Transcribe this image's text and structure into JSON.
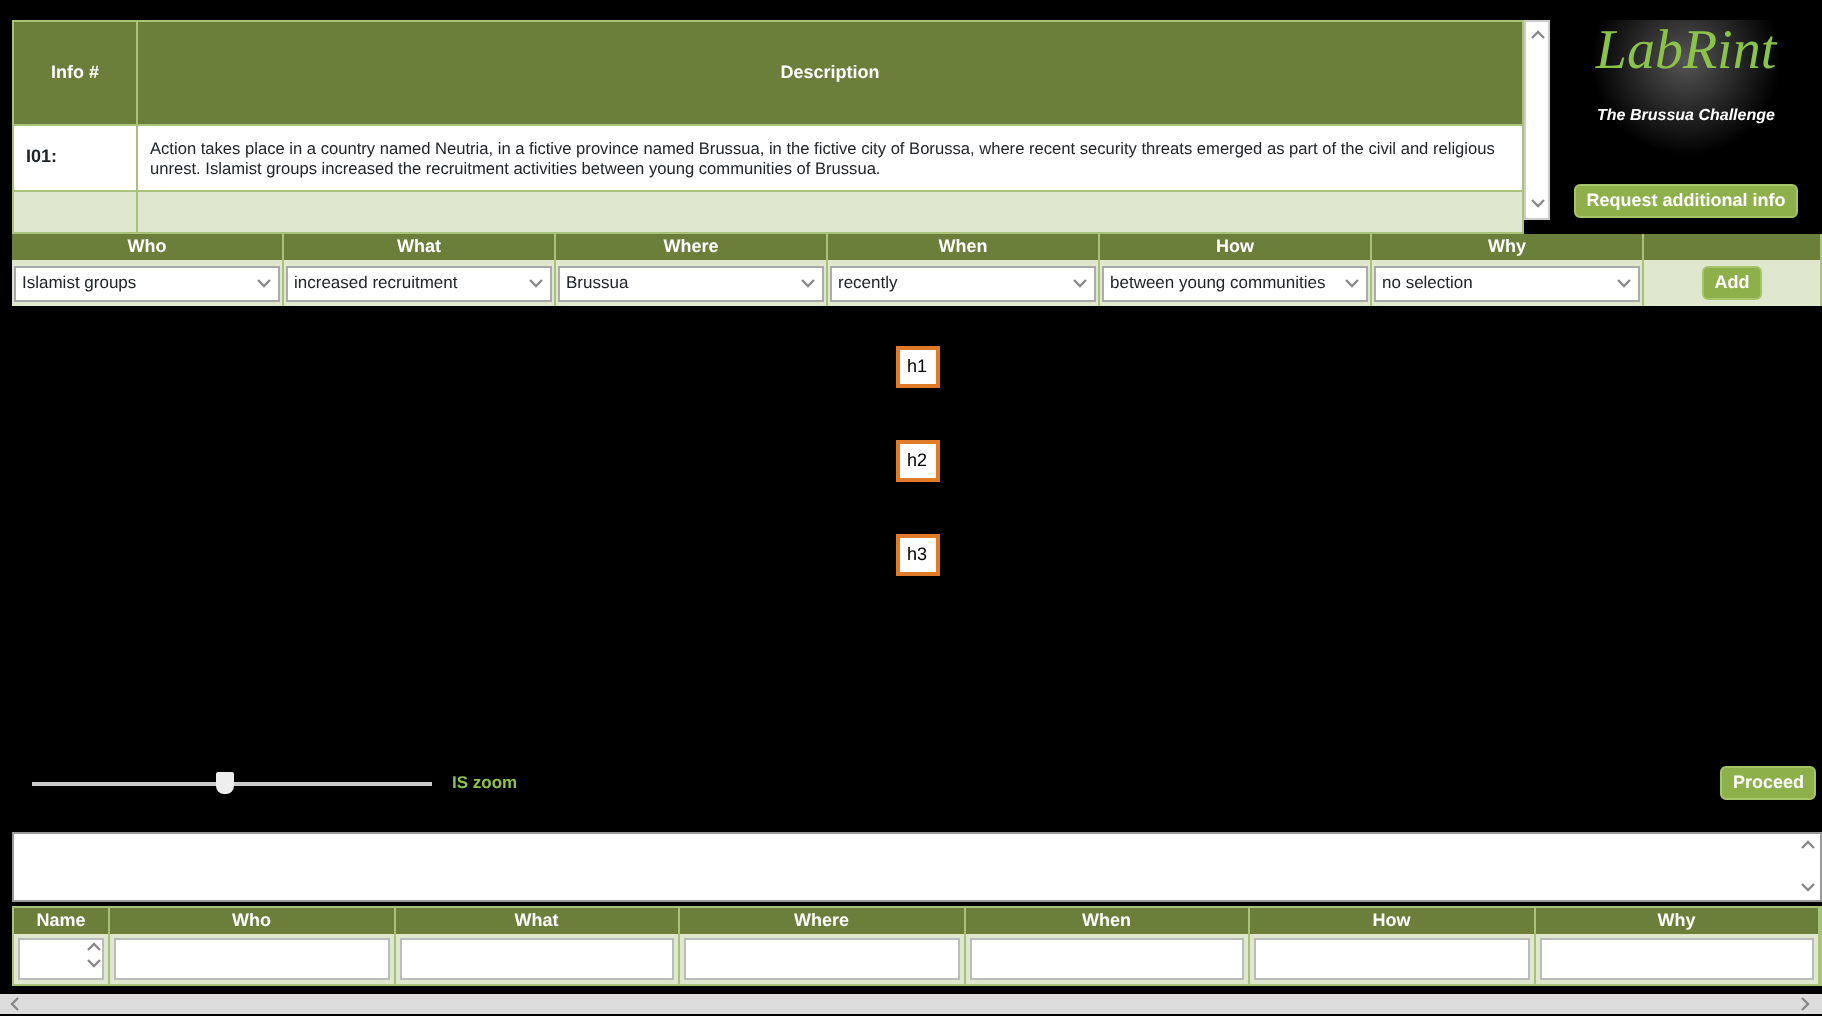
{
  "info_table": {
    "columns": [
      "Info #",
      "Description"
    ],
    "rows": [
      {
        "id": "I01:",
        "description": "Action takes place in a country named Neutria, in a fictive province named Brussua, in the fictive city of Borussa, where recent security threats emerged as part of the civil and religious unrest. Islamist groups increased the recruitment activities between young communities of Brussua."
      }
    ]
  },
  "logo": {
    "title": "LabRint",
    "subtitle": "The Brussua Challenge"
  },
  "request_button": "Request additional info",
  "filters": [
    {
      "label": "Who",
      "value": "Islamist groups"
    },
    {
      "label": "What",
      "value": "increased recruitment"
    },
    {
      "label": "Where",
      "value": "Brussua"
    },
    {
      "label": "When",
      "value": "recently"
    },
    {
      "label": "How",
      "value": "between young communities"
    },
    {
      "label": "Why",
      "value": "no selection"
    }
  ],
  "add_button": "Add",
  "nodes": [
    {
      "label": "h1"
    },
    {
      "label": "h2"
    },
    {
      "label": "h3"
    }
  ],
  "zoom": {
    "label": "IS zoom",
    "level": 0.48
  },
  "proceed_button": "Proceed",
  "bottom_table": {
    "columns": [
      "Name",
      "Who",
      "What",
      "Where",
      "When",
      "How",
      "Why"
    ]
  }
}
